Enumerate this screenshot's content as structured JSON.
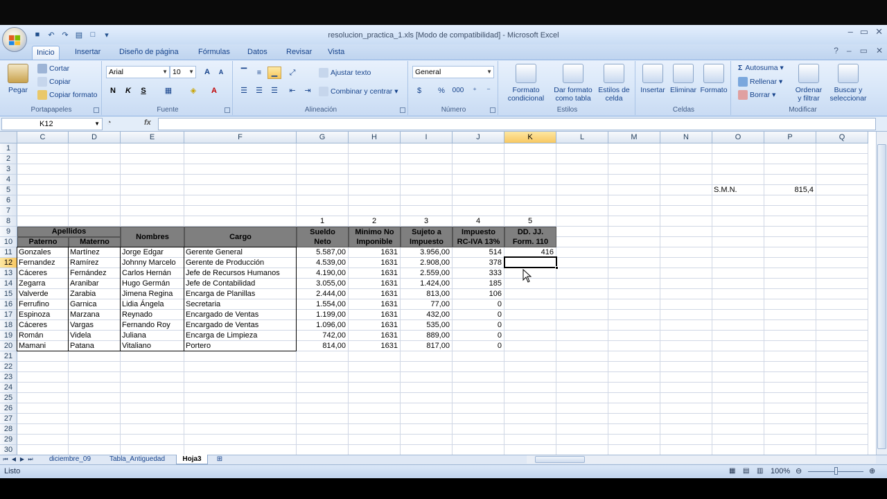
{
  "window": {
    "title": "resolucion_practica_1.xls  [Modo de compatibilidad] - Microsoft Excel"
  },
  "tabs": [
    "Inicio",
    "Insertar",
    "Diseño de página",
    "Fórmulas",
    "Datos",
    "Revisar",
    "Vista"
  ],
  "ribbon": {
    "clipboard": {
      "label": "Portapapeles",
      "paste": "Pegar",
      "cut": "Cortar",
      "copy": "Copiar",
      "format_painter": "Copiar formato"
    },
    "font": {
      "label": "Fuente",
      "name": "Arial",
      "size": "10",
      "bold": "N",
      "italic": "K",
      "underline": "S"
    },
    "alignment": {
      "label": "Alineación",
      "wrap": "Ajustar texto",
      "merge": "Combinar y centrar"
    },
    "number": {
      "label": "Número",
      "format": "General",
      "percent": "%",
      "thousands": "000"
    },
    "styles": {
      "label": "Estilos",
      "conditional": "Formato condicional",
      "as_table": "Dar formato como tabla",
      "cell_styles": "Estilos de celda"
    },
    "cells": {
      "label": "Celdas",
      "insert": "Insertar",
      "delete": "Eliminar",
      "format": "Formato"
    },
    "editing": {
      "label": "Modificar",
      "autosum": "Autosuma",
      "fill": "Rellenar",
      "clear": "Borrar",
      "sort": "Ordenar y filtrar",
      "find": "Buscar y seleccionar"
    }
  },
  "formula_bar": {
    "name_box": "K12",
    "fx": "fx",
    "value": ""
  },
  "columns": [
    "C",
    "D",
    "E",
    "F",
    "G",
    "H",
    "I",
    "J",
    "K",
    "L",
    "M",
    "N",
    "O",
    "P",
    "Q"
  ],
  "rows": [
    "1",
    "2",
    "3",
    "4",
    "5",
    "6",
    "7",
    "8",
    "9",
    "10",
    "11",
    "12",
    "13",
    "14",
    "15",
    "16",
    "17",
    "18",
    "19",
    "20",
    "21",
    "22",
    "23",
    "24",
    "25",
    "26",
    "27",
    "28",
    "29",
    "30"
  ],
  "sheet": {
    "smn_label": "S.M.N.",
    "smn_value": "815,4",
    "col_numbers": [
      "1",
      "2",
      "3",
      "4",
      "5"
    ],
    "headers": {
      "apellidos": "Apellidos",
      "paterno": "Paterno",
      "materno": "Materno",
      "nombres": "Nombres",
      "cargo": "Cargo",
      "sueldo": [
        "Sueldo",
        "Neto"
      ],
      "minimo": [
        "Minimo No",
        "Imponible"
      ],
      "sujeto": [
        "Sujeto a",
        "Impuesto"
      ],
      "impuesto": [
        "Impuesto",
        "RC-IVA 13%"
      ],
      "ddjj": [
        "DD. JJ.",
        "Form. 110"
      ]
    },
    "data": [
      [
        "Gonzales",
        "Martínez",
        "Jorge Edgar",
        "Gerente General",
        "5.587,00",
        "1631",
        "3.956,00",
        "514",
        "416"
      ],
      [
        "Fernandez",
        "Ramírez",
        "Johnny Marcelo",
        "Gerente de Producción",
        "4.539,00",
        "1631",
        "2.908,00",
        "378",
        ""
      ],
      [
        "Cáceres",
        "Fernández",
        "Carlos Hernán",
        "Jefe de Recursos Humanos",
        "4.190,00",
        "1631",
        "2.559,00",
        "333",
        ""
      ],
      [
        "Zegarra",
        "Aranibar",
        "Hugo Germán",
        "Jefe de Contabilidad",
        "3.055,00",
        "1631",
        "1.424,00",
        "185",
        ""
      ],
      [
        "Valverde",
        "Zarabia",
        "Jimena Regina",
        "Encarga de Planillas",
        "2.444,00",
        "1631",
        "813,00",
        "106",
        ""
      ],
      [
        "Ferrufino",
        "Garnica",
        "Lidia Ángela",
        "Secretaria",
        "1.554,00",
        "1631",
        "77,00",
        "0",
        ""
      ],
      [
        "Espinoza",
        "Marzana",
        "Reynado",
        "Encargado de Ventas",
        "1.199,00",
        "1631",
        "432,00",
        "0",
        ""
      ],
      [
        "Cáceres",
        "Vargas",
        "Fernando Roy",
        "Encargado de Ventas",
        "1.096,00",
        "1631",
        "535,00",
        "0",
        ""
      ],
      [
        "Román",
        "Videla",
        "Juliana",
        "Encarga de Limpieza",
        "742,00",
        "1631",
        "889,00",
        "0",
        ""
      ],
      [
        "Mamani",
        "Patana",
        "Vitaliano",
        "Portero",
        "814,00",
        "1631",
        "817,00",
        "0",
        ""
      ]
    ]
  },
  "sheet_tabs": [
    "diciembre_09",
    "Tabla_Antiguedad",
    "Hoja3"
  ],
  "status": {
    "ready": "Listo",
    "zoom": "100%"
  }
}
